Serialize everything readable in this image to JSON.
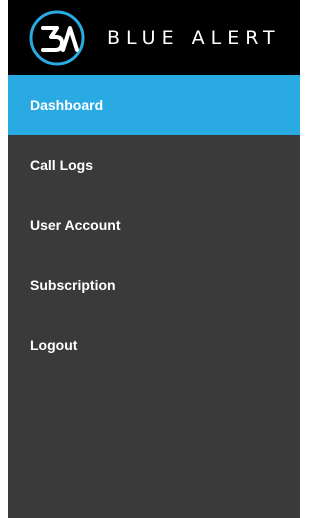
{
  "brand": {
    "name": "BLUE ALERT",
    "logo_icon": "blue-alert-logo-icon",
    "accent_color": "#29aae2"
  },
  "nav": {
    "items": [
      {
        "label": "Dashboard",
        "active": true
      },
      {
        "label": "Call Logs",
        "active": false
      },
      {
        "label": "User Account",
        "active": false
      },
      {
        "label": "Subscription",
        "active": false
      },
      {
        "label": "Logout",
        "active": false
      }
    ]
  },
  "colors": {
    "header_bg": "#000000",
    "sidebar_bg": "#3a3a3a",
    "active_bg": "#29aae2",
    "text": "#ffffff"
  }
}
